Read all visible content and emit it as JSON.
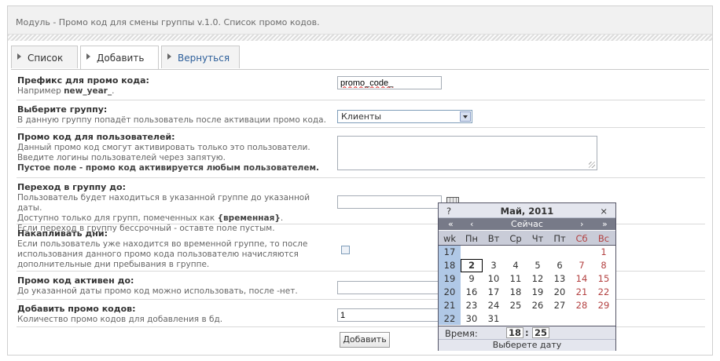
{
  "header": {
    "title": "Модуль - Промо код для смены группы v.1.0. Список промо кодов."
  },
  "tabs": [
    {
      "label": "Список"
    },
    {
      "label": "Добавить"
    },
    {
      "label": "Вернуться"
    }
  ],
  "form": {
    "prefix": {
      "title": "Префикс для промо кода:",
      "desc_prefix": "Например",
      "desc_example": "new_year_",
      "desc_suffix": ".",
      "value": "promo_code_"
    },
    "group": {
      "title": "Выберите группу:",
      "desc": "В данную группу попадёт пользователь после активации промо кода.",
      "value": "Клиенты"
    },
    "users": {
      "title": "Промо код для пользователей:",
      "desc": "Данный промо код смогут активировать только это пользователи. Введите логины пользователей через запятую.",
      "desc_bold": "Пустое поле - промо код активируется любым пользователем.",
      "value": ""
    },
    "transition": {
      "title": "Переход в группу до:",
      "desc1": "Пользователь будет находиться в указанной группе до указанной даты.",
      "desc2_prefix": "Доступно только для групп, помеченных как ",
      "desc2_bold": "{временная}",
      "desc2_suffix": ".",
      "desc3": "Если переход в группу бессрочный - оставте поле пустым.",
      "value": ""
    },
    "accumulate": {
      "title": "Накапливать дни:",
      "desc": "Если пользователь уже находится во временной группе, то после использования данного промо кода пользователю начисляются дополнительные дни пребывания в группе."
    },
    "active_until": {
      "title": "Промо код активен до:",
      "desc": "До указанной даты промо код можно использовать, после -нет.",
      "value": ""
    },
    "count": {
      "title": "Добавить промо кодов:",
      "desc": "Количество промо кодов для добавления в бд.",
      "value": "1"
    },
    "submit_label": "Добавить"
  },
  "calendar": {
    "help": "?",
    "title": "Май, 2011",
    "close": "×",
    "nav": {
      "prev_year": "«",
      "prev_month": "‹",
      "today": "Сейчас",
      "next_month": "›",
      "next_year": "»"
    },
    "weekday_header": [
      "wk",
      "Пн",
      "Вт",
      "Ср",
      "Чт",
      "Пт",
      "Сб",
      "Вс"
    ],
    "weeks": [
      {
        "wk": "17",
        "days": [
          "",
          "",
          "",
          "",
          "",
          "",
          "1"
        ]
      },
      {
        "wk": "18",
        "days": [
          "2",
          "3",
          "4",
          "5",
          "6",
          "7",
          "8"
        ]
      },
      {
        "wk": "19",
        "days": [
          "9",
          "10",
          "11",
          "12",
          "13",
          "14",
          "15"
        ]
      },
      {
        "wk": "20",
        "days": [
          "16",
          "17",
          "18",
          "19",
          "20",
          "21",
          "22"
        ]
      },
      {
        "wk": "21",
        "days": [
          "23",
          "24",
          "25",
          "26",
          "27",
          "28",
          "29"
        ]
      },
      {
        "wk": "22",
        "days": [
          "30",
          "31",
          "",
          "",
          "",
          "",
          ""
        ]
      }
    ],
    "selected_day": "2",
    "time_label": "Время:",
    "hour": "18",
    "minute": "25",
    "footer": "Выберете дату"
  },
  "colors": {
    "weekend": "#b34141",
    "week_column": "#b0c8e6",
    "link_tab": "#2d5f9a"
  }
}
